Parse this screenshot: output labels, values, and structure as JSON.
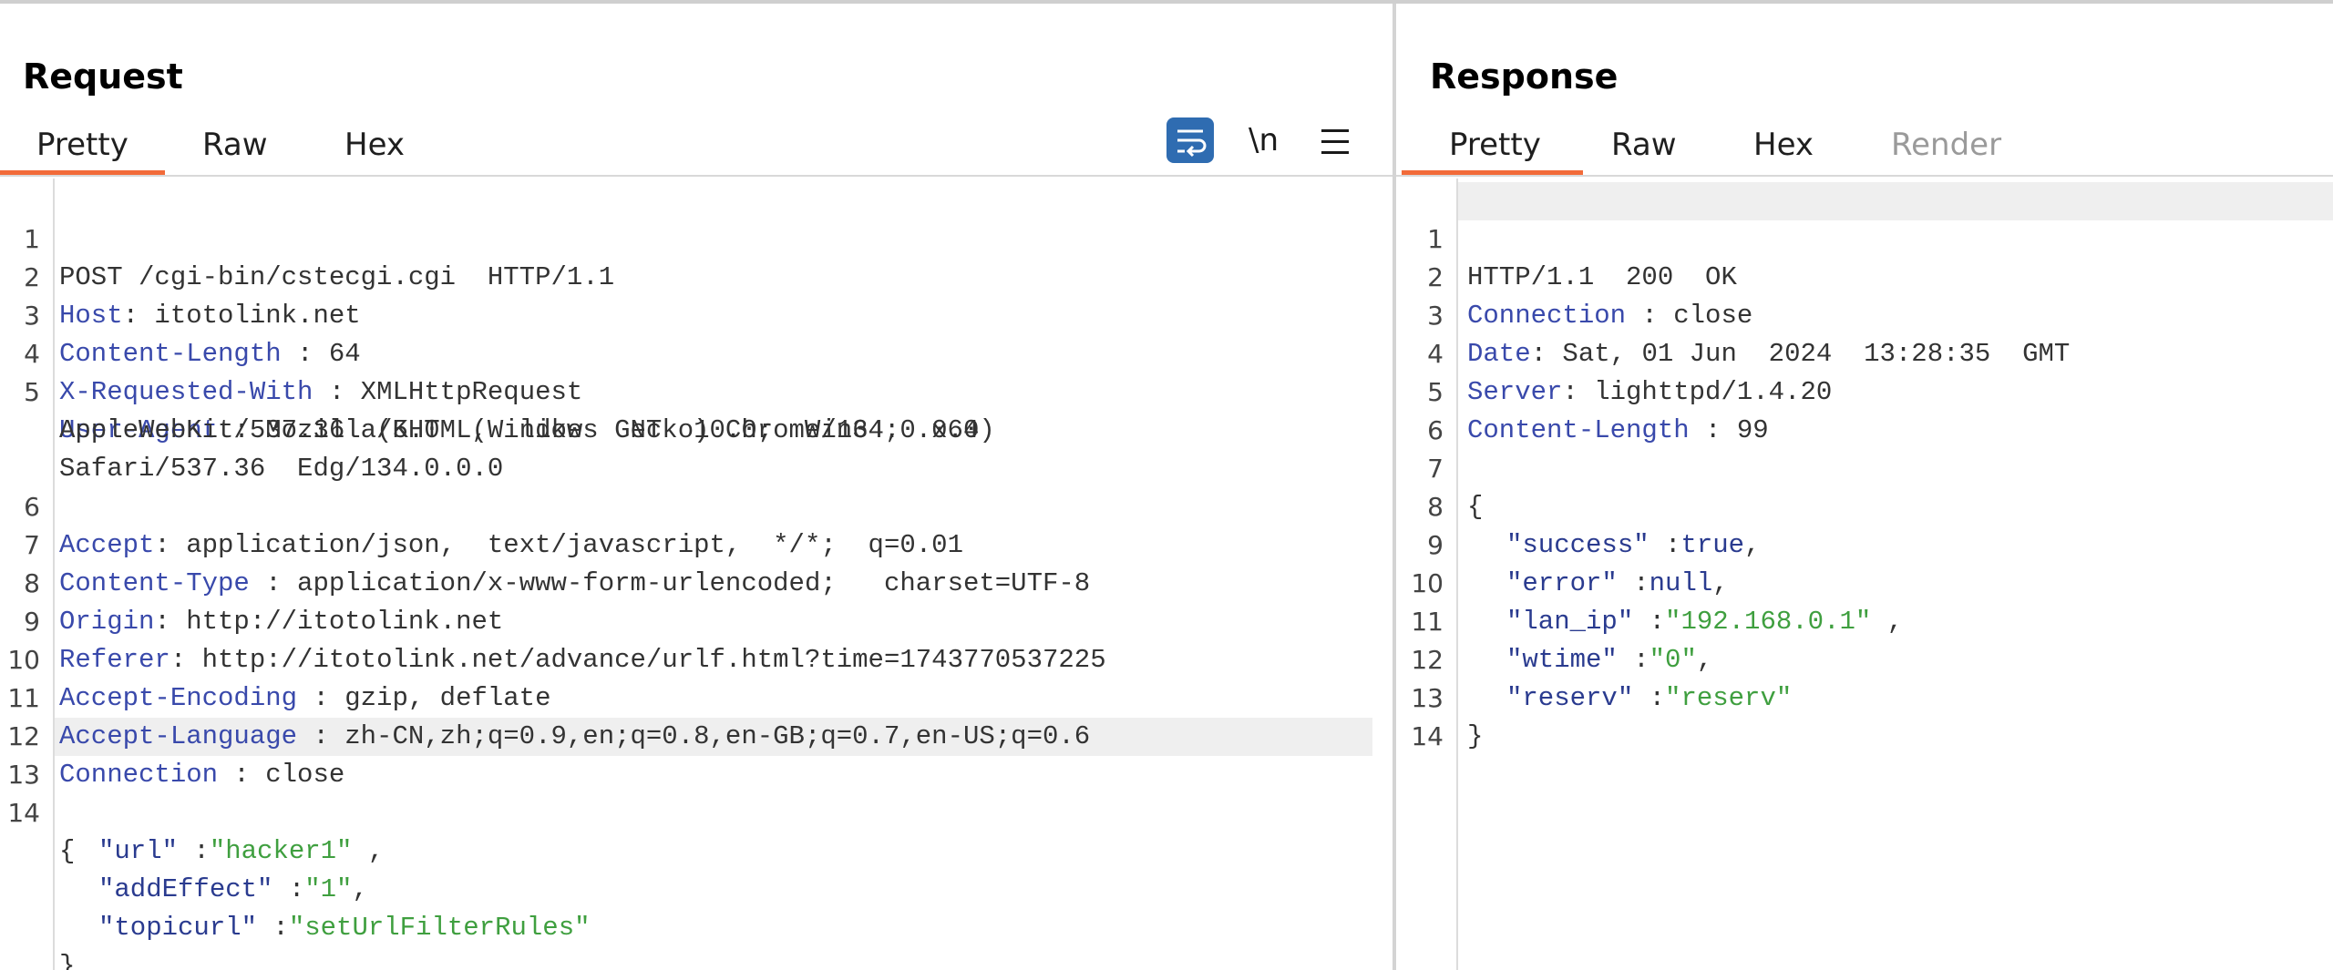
{
  "request": {
    "title": "Request",
    "tabs": [
      "Pretty",
      "Raw",
      "Hex"
    ],
    "active_tab": "Pretty",
    "toolbar": {
      "wrap_icon": "word-wrap-icon",
      "newline_label": "\\n",
      "menu_icon": "hamburger-menu-icon"
    },
    "lines": {
      "l1": "POST /cgi-bin/cstecgi.cgi  HTTP/1.1",
      "h2k": "Host",
      "h2v": ": itotolink.net",
      "h3k": "Content-Length",
      "h3v": " : 64",
      "h4k": "X-Requested-With",
      "h4v": " : XMLHttpRequest",
      "h5k": "User-Agent",
      "h5v": " : Mozilla/5.0  (Windows  NT  10.0;  Win64;  x64)",
      "h5c1": "AppleWebKit/537.36  (KHTML,  like  Gecko) Chrome/134.0.0.0",
      "h5c2": "Safari/537.36  Edg/134.0.0.0",
      "h6k": "Accept",
      "h6v": ": application/json,  text/javascript,  */*;  q=0.01",
      "h7k": "Content-Type",
      "h7v": " : application/x-www-form-urlencoded;   charset=UTF-8",
      "h8k": "Origin",
      "h8v": ": http://itotolink.net",
      "h9k": "Referer",
      "h9v": ": http://itotolink.net/advance/urlf.html?time=1743770537225",
      "h10k": "Accept-Encoding",
      "h10v": " : gzip, deflate",
      "h11k": "Accept-Language",
      "h11v": " : zh-CN,zh;q=0.9,en;q=0.8,en-GB;q=0.7,en-US;q=0.6",
      "h12k": "Connection",
      "h12v": " : close",
      "b_open": "{",
      "b1k": "\"url\"",
      "b1s": " :",
      "b1v": "\"hacker1\"",
      "b1e": " ,",
      "b2k": "\"addEffect\"",
      "b2s": " :",
      "b2v": "\"1\"",
      "b2e": ",",
      "b3k": "\"topicurl\"",
      "b3s": " :",
      "b3v": "\"setUrlFilterRules\"",
      "b_close": "}"
    }
  },
  "response": {
    "title": "Response",
    "tabs": [
      "Pretty",
      "Raw",
      "Hex",
      "Render"
    ],
    "active_tab": "Pretty",
    "lines": {
      "l1": "HTTP/1.1  200  OK",
      "h2k": "Connection",
      "h2v": " : close",
      "h3k": "Date",
      "h3v": ": Sat, 01 Jun  2024  13:28:35  GMT",
      "h4k": "Server",
      "h4v": ": lighttpd/1.4.20",
      "h5k": "Content-Length",
      "h5v": " : 99",
      "b_open": "{",
      "j1k": "\"success\"",
      "j1s": " :",
      "j1v": "true",
      "j1e": ",",
      "j2k": "\"error\"",
      "j2s": " :",
      "j2v": "null",
      "j2e": ",",
      "j3k": "\"lan_ip\"",
      "j3s": " :",
      "j3v": "\"192.168.0.1\"",
      "j3e": " ,",
      "j4k": "\"wtime\"",
      "j4s": " :",
      "j4v": "\"0\"",
      "j4e": ",",
      "j5k": "\"reserv\"",
      "j5s": " :",
      "j5v": "\"reserv\"",
      "b_close": "}"
    }
  },
  "line_numbers": {
    "n1": "1",
    "n2": "2",
    "n3": "3",
    "n4": "4",
    "n5": "5",
    "n6": "6",
    "n7": "7",
    "n8": "8",
    "n9": "9",
    "n10": "10",
    "n11": "11",
    "n12": "12",
    "n13": "13",
    "n14": "14"
  }
}
